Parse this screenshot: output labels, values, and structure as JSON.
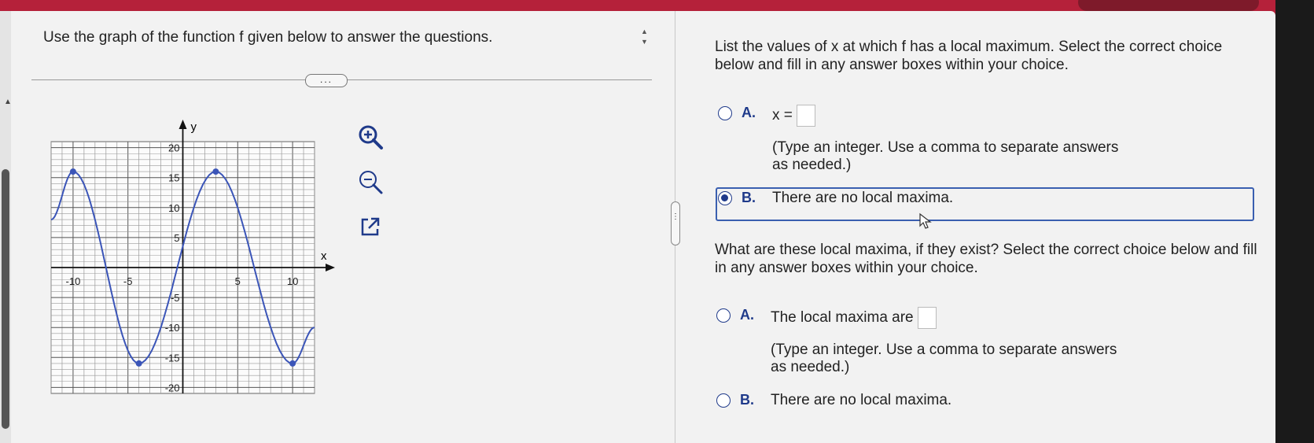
{
  "question": {
    "title": "Use the graph of the function f given below to answer the questions.",
    "more_label": "...",
    "handle_label": "⋮"
  },
  "tools": {
    "zoom_in_icon": "zoom-in-icon",
    "zoom_out_icon": "zoom-out-icon",
    "popout_icon": "external-link-icon"
  },
  "graph": {
    "y_axis_label": "y",
    "x_axis_label": "x",
    "x_ticks": [
      "-10",
      "-5",
      "5",
      "10"
    ],
    "y_ticks": [
      "20",
      "15",
      "10",
      "5",
      "-5",
      "-10",
      "-15",
      "-20"
    ],
    "curve_color": "#3b55b8",
    "points": [
      {
        "x": -10,
        "y": 16
      },
      {
        "x": -4,
        "y": -16
      },
      {
        "x": 3,
        "y": 16
      },
      {
        "x": 10,
        "y": -16
      }
    ]
  },
  "part1": {
    "prompt": "List the values of x at which f has a local maximum. Select the correct choice below and fill in any answer boxes within your choice.",
    "choice_a_letter": "A.",
    "choice_a_prefix": "x =",
    "choice_a_note_1": "(Type an integer. Use a comma to separate answers",
    "choice_a_note_2": "as needed.)",
    "choice_b_letter": "B.",
    "choice_b_text": "There are no local maxima.",
    "selected": "B"
  },
  "part2": {
    "prompt": "What are these local maxima, if they exist? Select the correct choice below and fill in any answer boxes within your choice.",
    "choice_a_letter": "A.",
    "choice_a_prefix": "The local maxima are",
    "choice_a_note_1": "(Type an integer. Use a comma to separate answers",
    "choice_a_note_2": "as needed.)",
    "choice_b_letter": "B.",
    "choice_b_text": "There are no local maxima."
  },
  "colors": {
    "accent": "#1f3a8a",
    "top_bar": "#b5213a"
  }
}
